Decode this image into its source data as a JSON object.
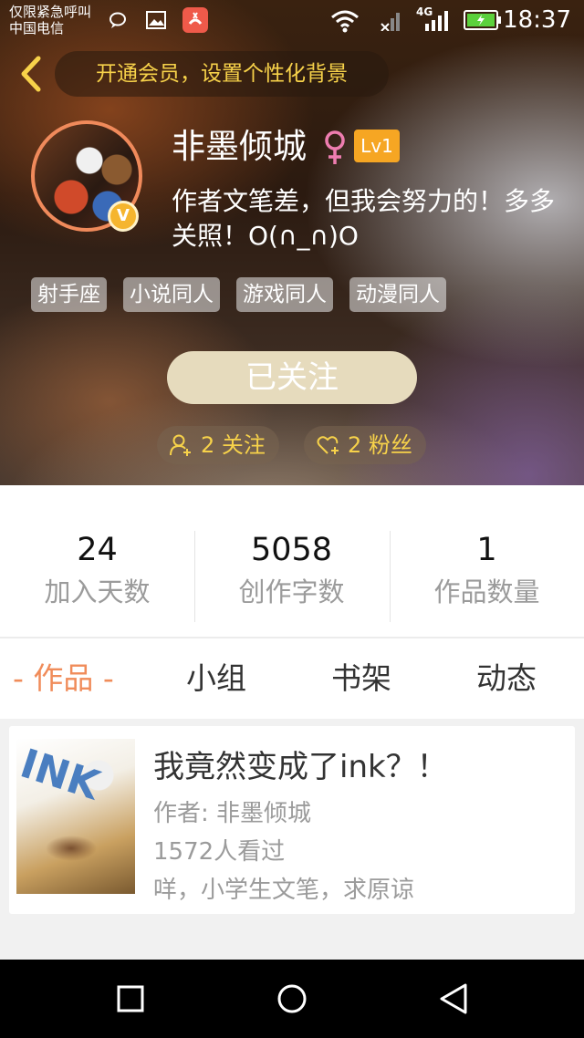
{
  "status_bar": {
    "carrier_line1": "仅限紧急呼叫",
    "carrier_line2": "中国电信",
    "network": "4G",
    "time": "18:37"
  },
  "header": {
    "promo_text": "开通会员，设置个性化背景"
  },
  "profile": {
    "username": "非墨倾城",
    "gender_symbol": "♀",
    "level": "Lv1",
    "vip_badge": "V",
    "bio": "作者文笔差，但我会努力的！多多关照！O(∩_∩)O",
    "tags": [
      "射手座",
      "小说同人",
      "游戏同人",
      "动漫同人"
    ],
    "follow_button": "已关注",
    "following_count": "2 关注",
    "fans_count": "2 粉丝"
  },
  "stats": [
    {
      "value": "24",
      "label": "加入天数"
    },
    {
      "value": "5058",
      "label": "创作字数"
    },
    {
      "value": "1",
      "label": "作品数量"
    }
  ],
  "tabs": [
    {
      "label": "- 作品 -",
      "active": true
    },
    {
      "label": "小组",
      "active": false
    },
    {
      "label": "书架",
      "active": false
    },
    {
      "label": "动态",
      "active": false
    }
  ],
  "works": [
    {
      "title": "我竟然变成了ink？！",
      "author": "作者: 非墨倾城",
      "views": "1572人看过",
      "description": "咩，小学生文笔，求原谅",
      "cover_text": "INK"
    }
  ],
  "colors": {
    "accent": "#f08c5a",
    "promo": "#f7d24a",
    "level_badge": "#f6a623",
    "follow_button": "#e6dbbd"
  }
}
